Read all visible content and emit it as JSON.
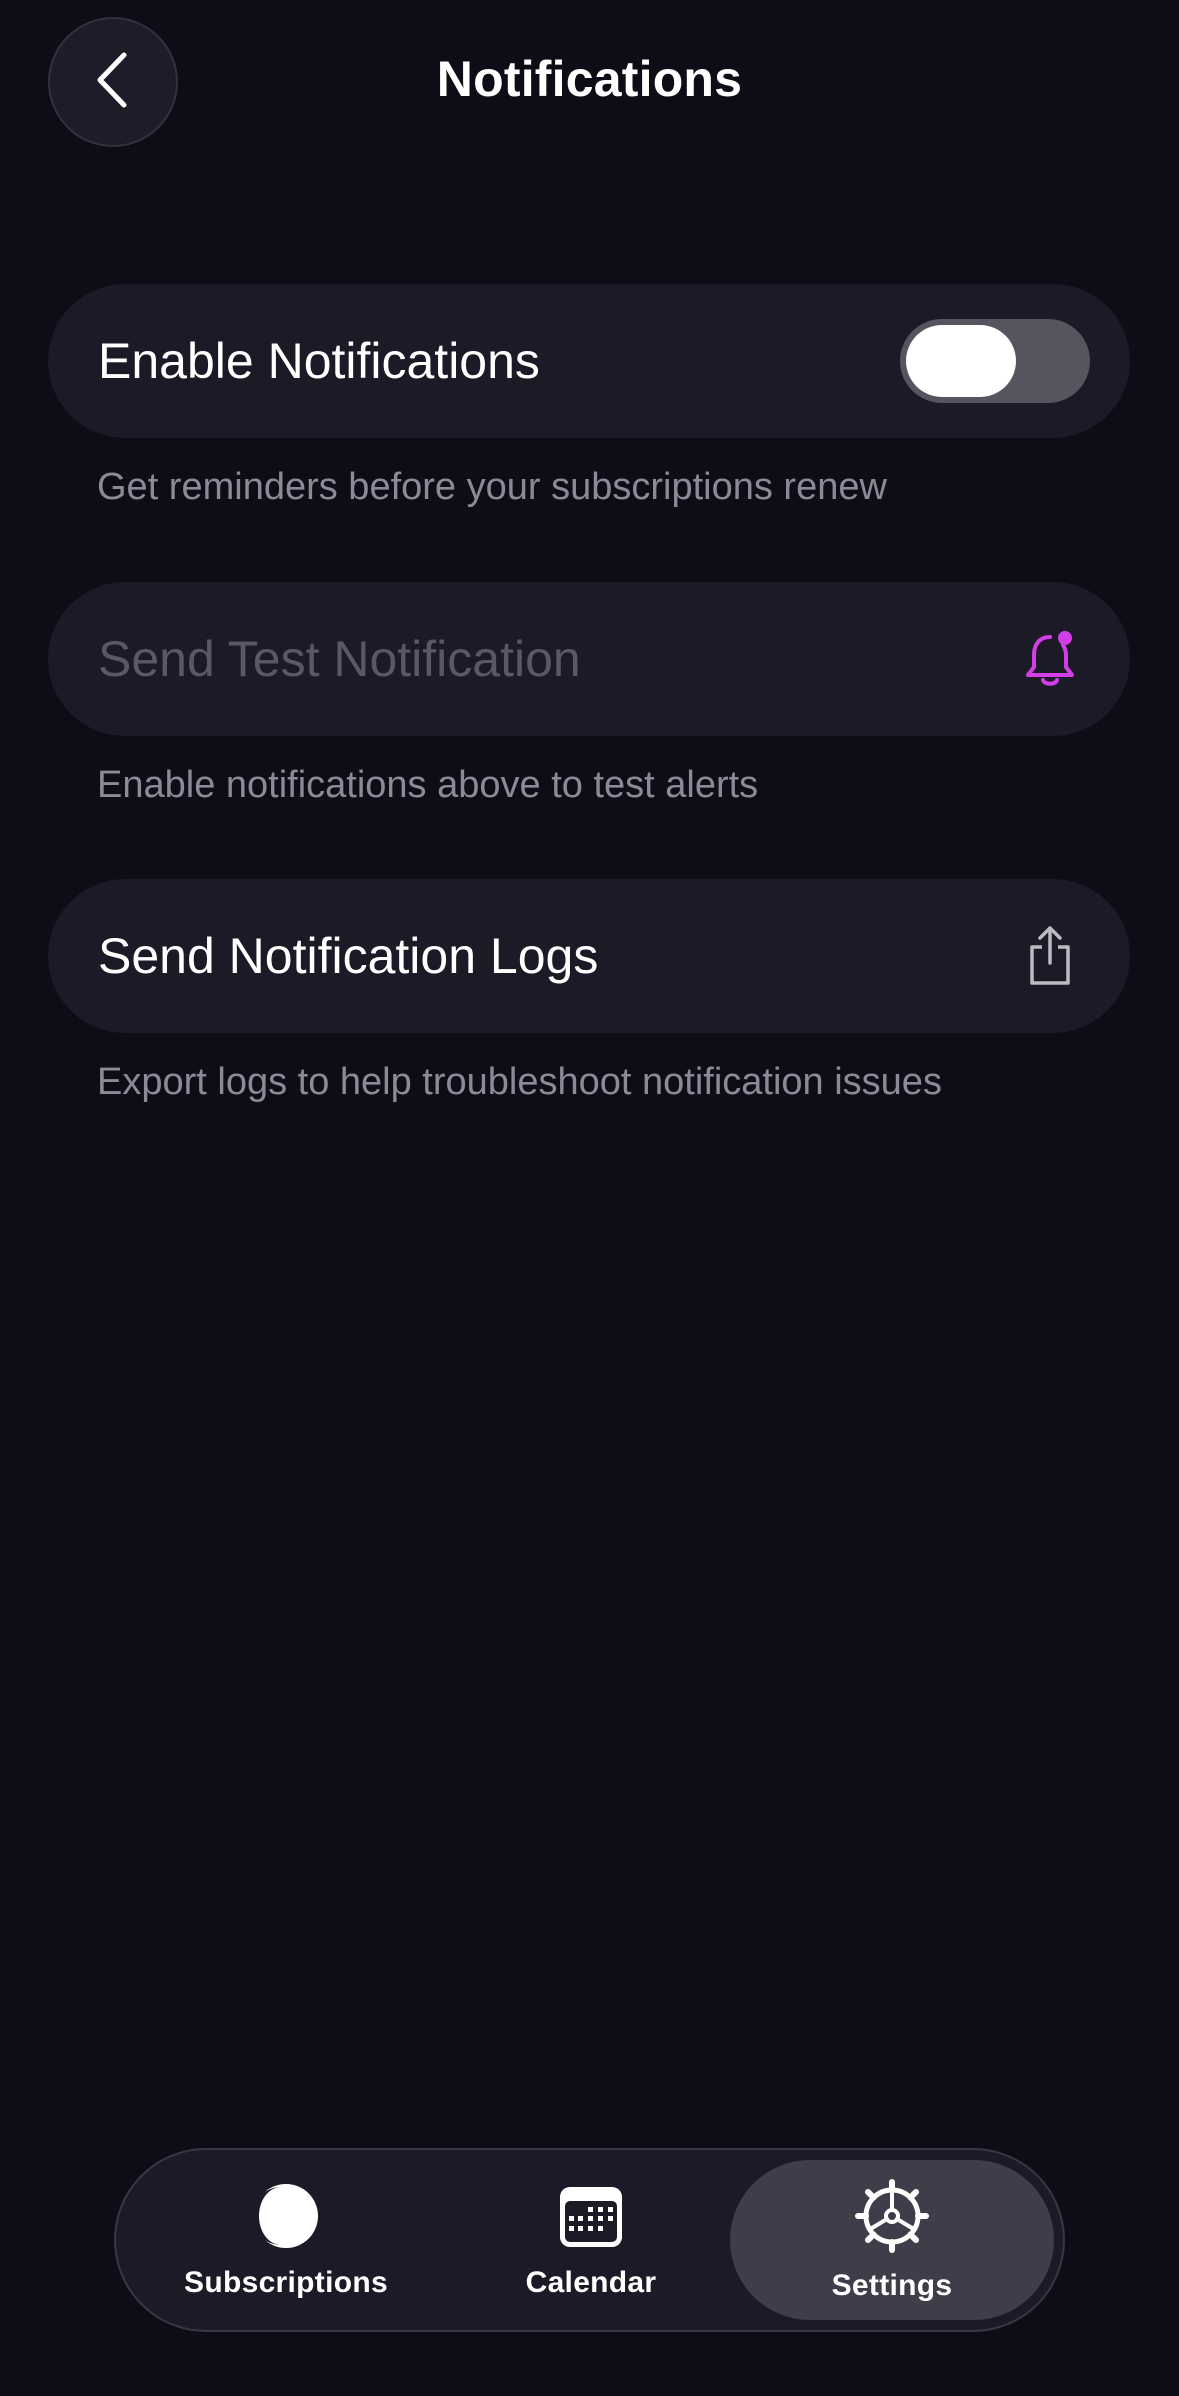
{
  "header": {
    "title": "Notifications",
    "back_icon": "chevron-left-icon"
  },
  "settings": {
    "enable": {
      "label": "Enable Notifications",
      "caption": "Get reminders before your subscriptions renew",
      "toggle_on": false
    },
    "test": {
      "label": "Send Test Notification",
      "caption": "Enable notifications above to test alerts",
      "icon": "bell-icon",
      "icon_color": "#d23ee8",
      "disabled": true
    },
    "logs": {
      "label": "Send Notification Logs",
      "caption": "Export logs to help troubleshoot notification issues",
      "icon": "share-icon"
    }
  },
  "tabbar": {
    "tabs": [
      {
        "label": "Subscriptions",
        "icon": "moon-icon",
        "active": false
      },
      {
        "label": "Calendar",
        "icon": "calendar-icon",
        "active": false
      },
      {
        "label": "Settings",
        "icon": "gear-icon",
        "active": true
      }
    ]
  },
  "colors": {
    "background": "#0e0c16",
    "card": "#1c1a26",
    "accent": "#d23ee8"
  }
}
